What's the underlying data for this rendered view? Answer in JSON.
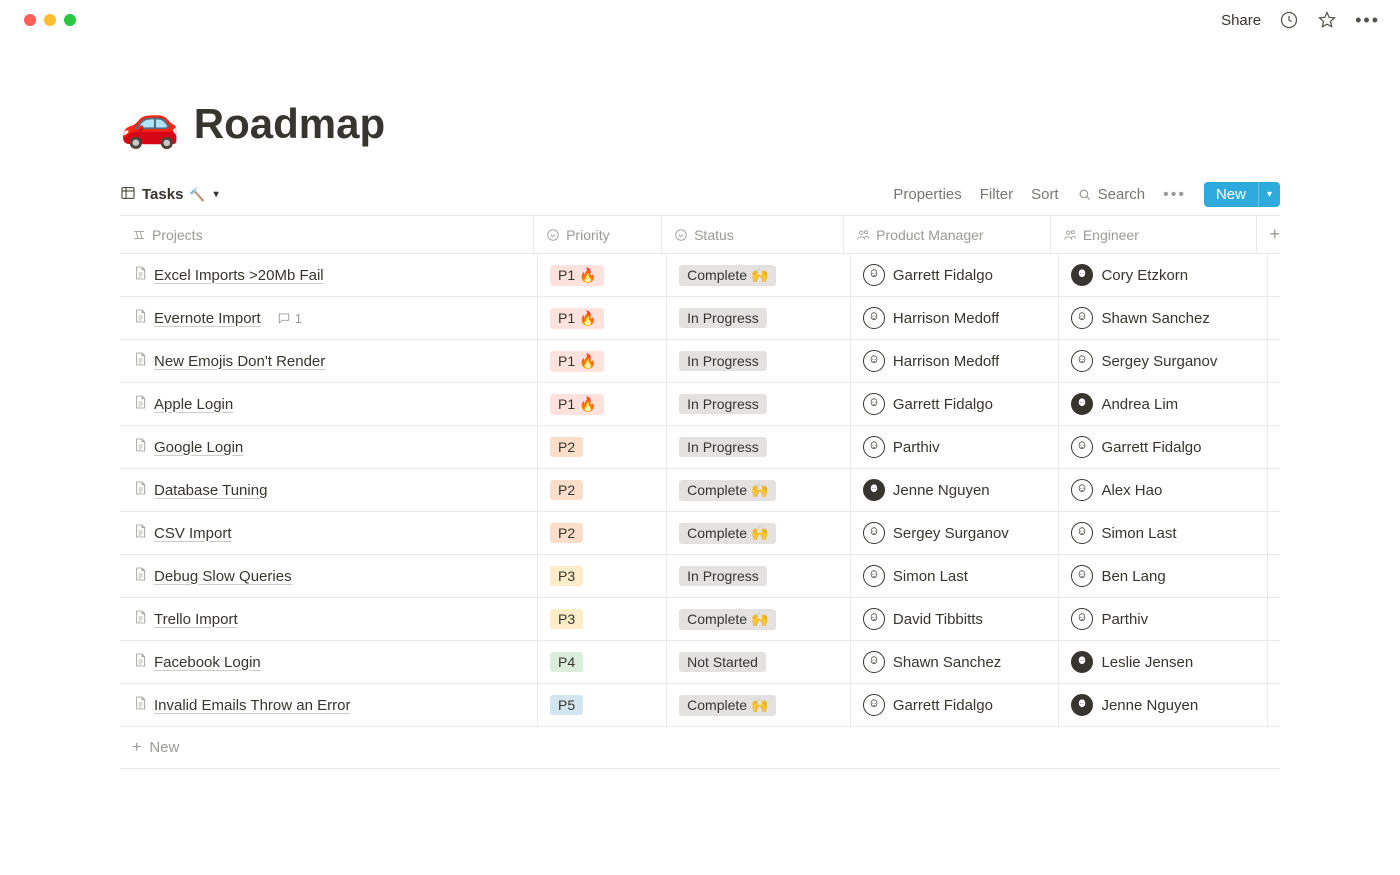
{
  "topbar": {
    "share": "Share"
  },
  "page": {
    "emoji": "🚗",
    "title": "Roadmap"
  },
  "view": {
    "name": "Tasks",
    "icon": "🔨"
  },
  "toolbar": {
    "properties": "Properties",
    "filter": "Filter",
    "sort": "Sort",
    "search": "Search",
    "new": "New"
  },
  "columns": {
    "projects": "Projects",
    "priority": "Priority",
    "status": "Status",
    "pm": "Product Manager",
    "engineer": "Engineer"
  },
  "priorityStyles": {
    "P1 🔥": "tag-p1",
    "P2": "tag-p2",
    "P3": "tag-p3",
    "P4": "tag-p4",
    "P5": "tag-p5"
  },
  "statusStyles": {
    "Complete 🙌": "tag-complete",
    "In Progress": "tag-progress",
    "Not Started": "tag-notstarted"
  },
  "darkAvatars": [
    "Cory Etzkorn",
    "Andrea Lim",
    "Jenne Nguyen",
    "Leslie Jensen"
  ],
  "rows": [
    {
      "title": "Excel Imports >20Mb Fail",
      "comments": 0,
      "priority": "P1 🔥",
      "status": "Complete 🙌",
      "pm": "Garrett Fidalgo",
      "eng": "Cory Etzkorn"
    },
    {
      "title": "Evernote Import",
      "comments": 1,
      "priority": "P1 🔥",
      "status": "In Progress",
      "pm": "Harrison Medoff",
      "eng": "Shawn Sanchez"
    },
    {
      "title": "New Emojis Don't Render",
      "comments": 0,
      "priority": "P1 🔥",
      "status": "In Progress",
      "pm": "Harrison Medoff",
      "eng": "Sergey Surganov"
    },
    {
      "title": "Apple Login",
      "comments": 0,
      "priority": "P1 🔥",
      "status": "In Progress",
      "pm": "Garrett Fidalgo",
      "eng": "Andrea Lim"
    },
    {
      "title": "Google Login",
      "comments": 0,
      "priority": "P2",
      "status": "In Progress",
      "pm": "Parthiv",
      "eng": "Garrett Fidalgo"
    },
    {
      "title": "Database Tuning",
      "comments": 0,
      "priority": "P2",
      "status": "Complete 🙌",
      "pm": "Jenne Nguyen",
      "eng": "Alex Hao"
    },
    {
      "title": "CSV Import",
      "comments": 0,
      "priority": "P2",
      "status": "Complete 🙌",
      "pm": "Sergey Surganov",
      "eng": "Simon Last"
    },
    {
      "title": "Debug Slow Queries",
      "comments": 0,
      "priority": "P3",
      "status": "In Progress",
      "pm": "Simon Last",
      "eng": "Ben Lang"
    },
    {
      "title": "Trello Import",
      "comments": 0,
      "priority": "P3",
      "status": "Complete 🙌",
      "pm": "David Tibbitts",
      "eng": "Parthiv"
    },
    {
      "title": "Facebook Login",
      "comments": 0,
      "priority": "P4",
      "status": "Not Started",
      "pm": "Shawn Sanchez",
      "eng": "Leslie Jensen"
    },
    {
      "title": "Invalid Emails Throw an Error",
      "comments": 0,
      "priority": "P5",
      "status": "Complete 🙌",
      "pm": "Garrett Fidalgo",
      "eng": "Jenne Nguyen"
    }
  ],
  "addrow": "New"
}
